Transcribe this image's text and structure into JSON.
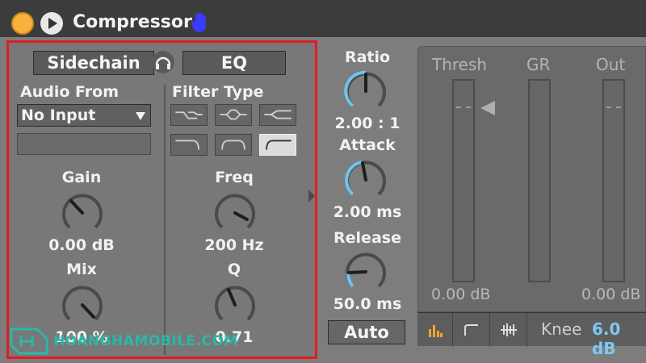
{
  "device": {
    "title": "Compressor"
  },
  "sidechain": {
    "sidechain_label": "Sidechain",
    "eq_label": "EQ",
    "audio_from_label": "Audio From",
    "audio_from_value": "No Input",
    "filter_type_label": "Filter Type",
    "gain_label": "Gain",
    "gain_value": "0.00 dB",
    "mix_label": "Mix",
    "mix_value": "100 %",
    "freq_label": "Freq",
    "freq_value": "200 Hz",
    "q_label": "Q",
    "q_value": "0.71"
  },
  "compressor": {
    "ratio_label": "Ratio",
    "ratio_value": "2.00 : 1",
    "attack_label": "Attack",
    "attack_value": "2.00 ms",
    "release_label": "Release",
    "release_value": "50.0 ms",
    "auto_label": "Auto"
  },
  "meters": {
    "thresh_label": "Thresh",
    "gr_label": "GR",
    "out_label": "Out",
    "thresh_value": "0.00 dB",
    "out_value": "0.00 dB"
  },
  "knee": {
    "label": "Knee",
    "value": "6.0 dB"
  },
  "watermark": {
    "text": "HOANGHAMOBILE.COM"
  },
  "colors": {
    "accent_blue": "#6ec3ee",
    "highlight_red": "#e31b23",
    "power_orange": "#f7b13c"
  }
}
